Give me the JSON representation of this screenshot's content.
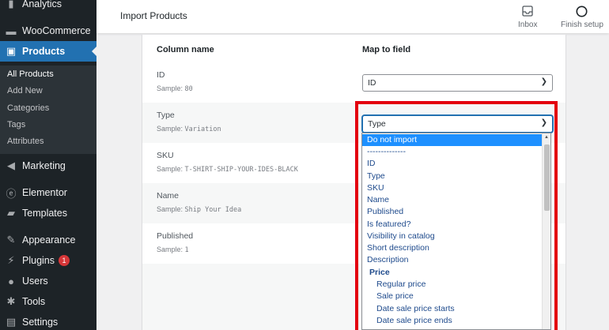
{
  "sidebar": {
    "items": [
      {
        "label": "Analytics",
        "icon": "bar-chart-icon"
      },
      {
        "label": "WooCommerce",
        "icon": "woo-icon"
      },
      {
        "label": "Products",
        "icon": "archive-icon"
      },
      {
        "label": "Marketing",
        "icon": "megaphone-icon"
      },
      {
        "label": "Elementor",
        "icon": "elementor-icon"
      },
      {
        "label": "Templates",
        "icon": "folder-icon"
      },
      {
        "label": "Appearance",
        "icon": "brush-icon"
      },
      {
        "label": "Plugins",
        "icon": "plug-icon",
        "badge": "1"
      },
      {
        "label": "Users",
        "icon": "user-icon"
      },
      {
        "label": "Tools",
        "icon": "wrench-icon"
      },
      {
        "label": "Settings",
        "icon": "settings-icon"
      }
    ],
    "submenu": [
      "All Products",
      "Add New",
      "Categories",
      "Tags",
      "Attributes"
    ]
  },
  "header": {
    "title": "Import Products",
    "inbox_label": "Inbox",
    "finish_label": "Finish setup"
  },
  "table": {
    "col_name": "Column name",
    "col_map": "Map to field",
    "sample_prefix": "Sample:",
    "rows": [
      {
        "name": "ID",
        "sample": "80",
        "mapped": "ID"
      },
      {
        "name": "Type",
        "sample": "Variation",
        "mapped": "Type"
      },
      {
        "name": "SKU",
        "sample": "T-SHIRT-SHIP-YOUR-IDES-BLACK",
        "mapped": ""
      },
      {
        "name": "Name",
        "sample": "Ship Your Idea",
        "mapped": ""
      },
      {
        "name": "Published",
        "sample": "1",
        "mapped": ""
      }
    ]
  },
  "dropdown": {
    "options": [
      {
        "label": "Do not import",
        "kind": "selected"
      },
      {
        "label": "--------------",
        "kind": "normal"
      },
      {
        "label": "ID",
        "kind": "normal"
      },
      {
        "label": "Type",
        "kind": "normal"
      },
      {
        "label": "SKU",
        "kind": "normal"
      },
      {
        "label": "Name",
        "kind": "normal"
      },
      {
        "label": "Published",
        "kind": "normal"
      },
      {
        "label": "Is featured?",
        "kind": "normal"
      },
      {
        "label": "Visibility in catalog",
        "kind": "normal"
      },
      {
        "label": "Short description",
        "kind": "normal"
      },
      {
        "label": "Description",
        "kind": "normal"
      },
      {
        "label": "Price",
        "kind": "group"
      },
      {
        "label": "Regular price",
        "kind": "child"
      },
      {
        "label": "Sale price",
        "kind": "child"
      },
      {
        "label": "Date sale price starts",
        "kind": "child"
      },
      {
        "label": "Date sale price ends",
        "kind": "child"
      }
    ]
  },
  "colors": {
    "sidebar_bg": "#1d2327",
    "active": "#2271b1",
    "highlight": "#e3000f",
    "option_selected": "#1e90ff"
  }
}
